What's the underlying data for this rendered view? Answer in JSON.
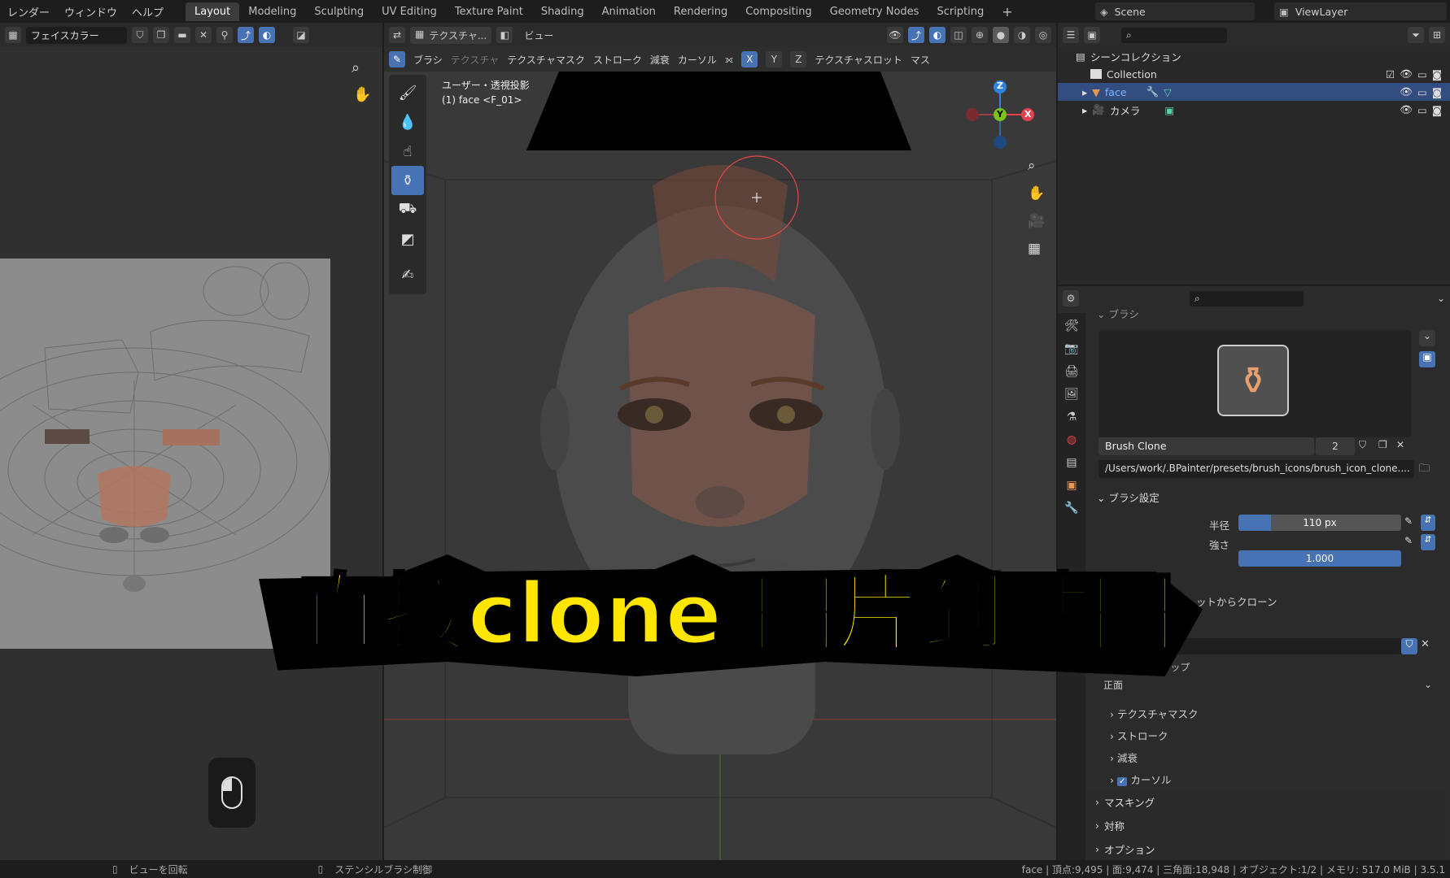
{
  "topbar": {
    "menus": [
      "レンダー",
      "ウィンドウ",
      "ヘルプ"
    ],
    "workspaces": [
      "Layout",
      "Modeling",
      "Sculpting",
      "UV Editing",
      "Texture Paint",
      "Shading",
      "Animation",
      "Rendering",
      "Compositing",
      "Geometry Nodes",
      "Scripting"
    ],
    "active_workspace": "Layout",
    "add_tab": "+",
    "scene_name": "Scene",
    "view_layer_name": "ViewLayer"
  },
  "image_editor": {
    "image_name": "フェイスカラー"
  },
  "viewport": {
    "header": {
      "mode_label": "テクスチャ...",
      "view_menu": "ビュー",
      "brush_menu": "ブラシ",
      "texture_menu": "テクスチャ",
      "texture_mask_menu": "テクスチャマスク",
      "stroke_menu": "ストローク",
      "falloff_menu": "減衰",
      "cursor_menu": "カーソル",
      "axis_x": "X",
      "axis_y": "Y",
      "axis_z": "Z",
      "texture_slot_menu": "テクスチャスロット",
      "mask_menu": "マス"
    },
    "overlay_title": "ユーザー・透視投影",
    "overlay_subtitle": "(1) face <F_01>",
    "gizmo_axes": [
      "X",
      "Y",
      "Z"
    ]
  },
  "caption": "直接clone 图片到贴图",
  "outliner": {
    "scene_collection": "シーンコレクション",
    "rows": [
      {
        "name": "Collection"
      },
      {
        "name": "face"
      },
      {
        "name": "カメラ"
      }
    ]
  },
  "properties": {
    "brush_section": "ブラシ",
    "brush_name": "Brush Clone",
    "brush_users": "2",
    "brush_icon_path": "/Users/work/.BPainter/presets/brush_icons/brush_icon_clone....",
    "brush_settings_section": "ブラシ設定",
    "radius_label": "半径",
    "radius_value": "110 px",
    "radius_fill": 0.2,
    "strength_label": "強さ",
    "strength_value": "1.000",
    "strength_fill": 1.0,
    "clone_from_label": "ットからクローン",
    "clone_uv_label": "クローン元UVマップ",
    "clone_uv_value": "正面",
    "sub_panels": [
      "テクスチャマスク",
      "ストローク",
      "減衰",
      "カーソル"
    ],
    "sections": [
      "マスキング",
      "対称",
      "オプション"
    ]
  },
  "statusbar": {
    "left_hint": "ビューを回転",
    "mid_hint": "ステンシルブラシ制御",
    "stats": "face | 頂点:9,495 | 面:9,474 | 三角面:18,948 | オブジェクト:1/2 | メモリ: 517.0 MiB | 3.5.1"
  },
  "colors": {
    "accent": "#4772b3",
    "caption_fill": "#ffe600",
    "caption_stroke": "#000000",
    "gizmo_x": "#e2424f",
    "gizmo_y": "#7bc21e",
    "gizmo_z": "#2f84e3"
  }
}
